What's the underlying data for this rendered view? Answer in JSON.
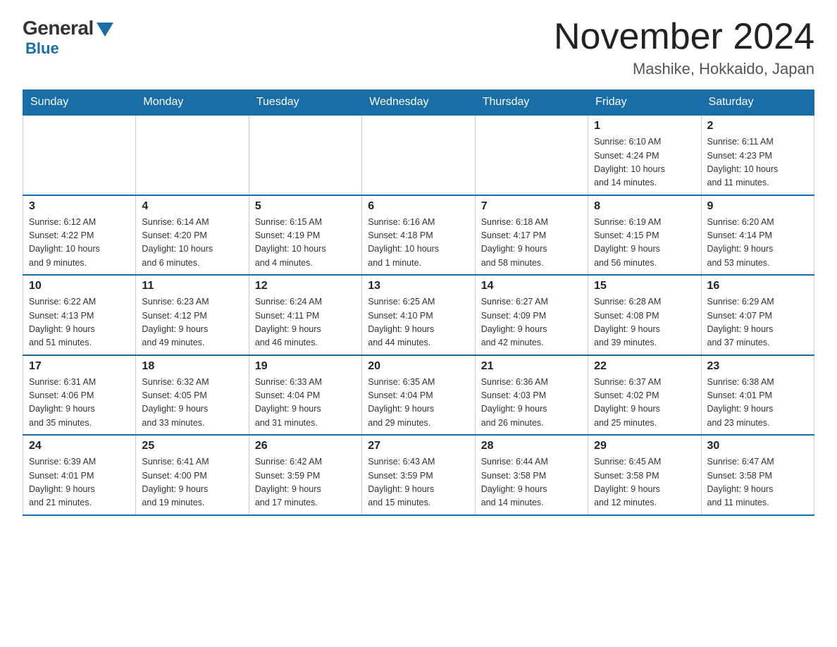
{
  "header": {
    "month_year": "November 2024",
    "location": "Mashike, Hokkaido, Japan",
    "logo_general": "General",
    "logo_blue": "Blue"
  },
  "weekdays": [
    "Sunday",
    "Monday",
    "Tuesday",
    "Wednesday",
    "Thursday",
    "Friday",
    "Saturday"
  ],
  "weeks": [
    [
      {
        "day": "",
        "info": ""
      },
      {
        "day": "",
        "info": ""
      },
      {
        "day": "",
        "info": ""
      },
      {
        "day": "",
        "info": ""
      },
      {
        "day": "",
        "info": ""
      },
      {
        "day": "1",
        "info": "Sunrise: 6:10 AM\nSunset: 4:24 PM\nDaylight: 10 hours\nand 14 minutes."
      },
      {
        "day": "2",
        "info": "Sunrise: 6:11 AM\nSunset: 4:23 PM\nDaylight: 10 hours\nand 11 minutes."
      }
    ],
    [
      {
        "day": "3",
        "info": "Sunrise: 6:12 AM\nSunset: 4:22 PM\nDaylight: 10 hours\nand 9 minutes."
      },
      {
        "day": "4",
        "info": "Sunrise: 6:14 AM\nSunset: 4:20 PM\nDaylight: 10 hours\nand 6 minutes."
      },
      {
        "day": "5",
        "info": "Sunrise: 6:15 AM\nSunset: 4:19 PM\nDaylight: 10 hours\nand 4 minutes."
      },
      {
        "day": "6",
        "info": "Sunrise: 6:16 AM\nSunset: 4:18 PM\nDaylight: 10 hours\nand 1 minute."
      },
      {
        "day": "7",
        "info": "Sunrise: 6:18 AM\nSunset: 4:17 PM\nDaylight: 9 hours\nand 58 minutes."
      },
      {
        "day": "8",
        "info": "Sunrise: 6:19 AM\nSunset: 4:15 PM\nDaylight: 9 hours\nand 56 minutes."
      },
      {
        "day": "9",
        "info": "Sunrise: 6:20 AM\nSunset: 4:14 PM\nDaylight: 9 hours\nand 53 minutes."
      }
    ],
    [
      {
        "day": "10",
        "info": "Sunrise: 6:22 AM\nSunset: 4:13 PM\nDaylight: 9 hours\nand 51 minutes."
      },
      {
        "day": "11",
        "info": "Sunrise: 6:23 AM\nSunset: 4:12 PM\nDaylight: 9 hours\nand 49 minutes."
      },
      {
        "day": "12",
        "info": "Sunrise: 6:24 AM\nSunset: 4:11 PM\nDaylight: 9 hours\nand 46 minutes."
      },
      {
        "day": "13",
        "info": "Sunrise: 6:25 AM\nSunset: 4:10 PM\nDaylight: 9 hours\nand 44 minutes."
      },
      {
        "day": "14",
        "info": "Sunrise: 6:27 AM\nSunset: 4:09 PM\nDaylight: 9 hours\nand 42 minutes."
      },
      {
        "day": "15",
        "info": "Sunrise: 6:28 AM\nSunset: 4:08 PM\nDaylight: 9 hours\nand 39 minutes."
      },
      {
        "day": "16",
        "info": "Sunrise: 6:29 AM\nSunset: 4:07 PM\nDaylight: 9 hours\nand 37 minutes."
      }
    ],
    [
      {
        "day": "17",
        "info": "Sunrise: 6:31 AM\nSunset: 4:06 PM\nDaylight: 9 hours\nand 35 minutes."
      },
      {
        "day": "18",
        "info": "Sunrise: 6:32 AM\nSunset: 4:05 PM\nDaylight: 9 hours\nand 33 minutes."
      },
      {
        "day": "19",
        "info": "Sunrise: 6:33 AM\nSunset: 4:04 PM\nDaylight: 9 hours\nand 31 minutes."
      },
      {
        "day": "20",
        "info": "Sunrise: 6:35 AM\nSunset: 4:04 PM\nDaylight: 9 hours\nand 29 minutes."
      },
      {
        "day": "21",
        "info": "Sunrise: 6:36 AM\nSunset: 4:03 PM\nDaylight: 9 hours\nand 26 minutes."
      },
      {
        "day": "22",
        "info": "Sunrise: 6:37 AM\nSunset: 4:02 PM\nDaylight: 9 hours\nand 25 minutes."
      },
      {
        "day": "23",
        "info": "Sunrise: 6:38 AM\nSunset: 4:01 PM\nDaylight: 9 hours\nand 23 minutes."
      }
    ],
    [
      {
        "day": "24",
        "info": "Sunrise: 6:39 AM\nSunset: 4:01 PM\nDaylight: 9 hours\nand 21 minutes."
      },
      {
        "day": "25",
        "info": "Sunrise: 6:41 AM\nSunset: 4:00 PM\nDaylight: 9 hours\nand 19 minutes."
      },
      {
        "day": "26",
        "info": "Sunrise: 6:42 AM\nSunset: 3:59 PM\nDaylight: 9 hours\nand 17 minutes."
      },
      {
        "day": "27",
        "info": "Sunrise: 6:43 AM\nSunset: 3:59 PM\nDaylight: 9 hours\nand 15 minutes."
      },
      {
        "day": "28",
        "info": "Sunrise: 6:44 AM\nSunset: 3:58 PM\nDaylight: 9 hours\nand 14 minutes."
      },
      {
        "day": "29",
        "info": "Sunrise: 6:45 AM\nSunset: 3:58 PM\nDaylight: 9 hours\nand 12 minutes."
      },
      {
        "day": "30",
        "info": "Sunrise: 6:47 AM\nSunset: 3:58 PM\nDaylight: 9 hours\nand 11 minutes."
      }
    ]
  ]
}
